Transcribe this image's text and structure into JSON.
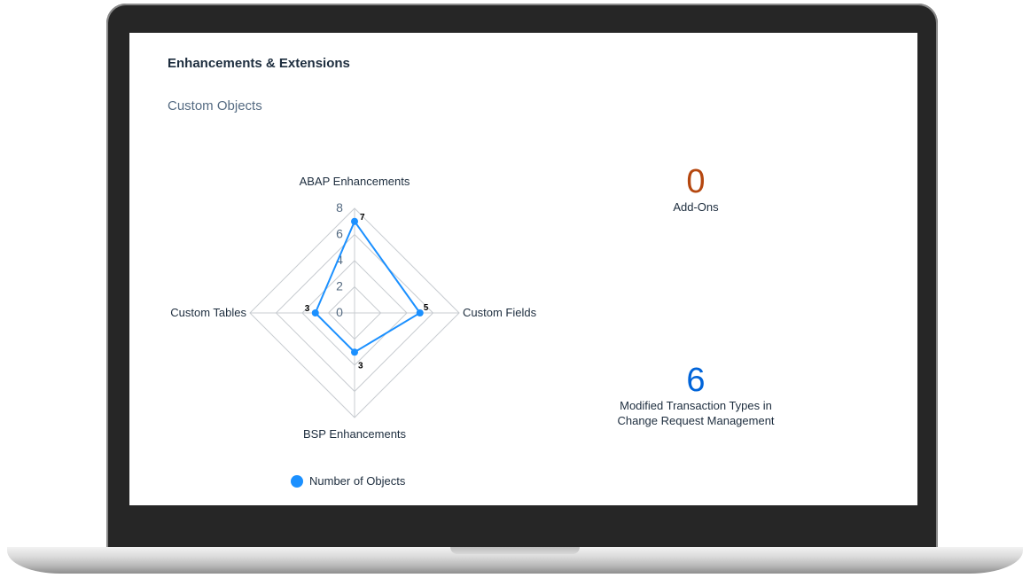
{
  "section_title": "Enhancements & Extensions",
  "card_subtitle": "Custom Objects",
  "chart_data": {
    "type": "radar",
    "title": "Custom Objects",
    "axes": [
      "ABAP Enhancements",
      "Custom Fields",
      "BSP Enhancements",
      "Custom Tables"
    ],
    "tick_labels": [
      "0",
      "2",
      "4",
      "6",
      "8"
    ],
    "ylim": [
      0,
      8
    ],
    "grid": true,
    "legend_position": "bottom",
    "series": [
      {
        "name": "Number of Objects",
        "values": [
          7,
          5,
          3,
          3
        ],
        "data_labels": [
          "7",
          "5",
          "3",
          "3"
        ],
        "color": "#1b90ff"
      }
    ]
  },
  "kpis": [
    {
      "value": "0",
      "label": "Add-Ons",
      "color": "#b5470f"
    },
    {
      "value": "6",
      "label": "Modified Transaction Types in Change Request Management",
      "color": "#0064d9"
    }
  ],
  "colors": {
    "grid": "#c8ccd1",
    "axis_text": "#1d2d3e",
    "tick_text": "#556b82",
    "bezel": "#262626"
  }
}
